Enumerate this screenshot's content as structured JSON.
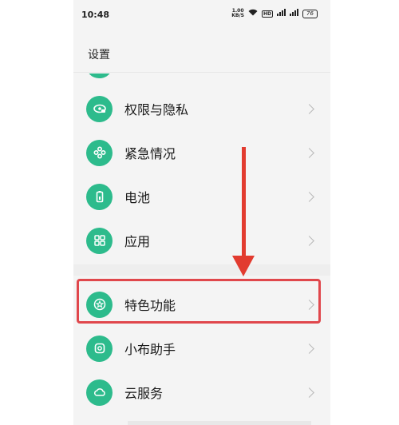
{
  "status_bar": {
    "time": "10:48",
    "net_speed_value": "1.00",
    "net_speed_unit": "KB/S",
    "hd_label": "HD",
    "battery_level": "76"
  },
  "header": {
    "title": "设置"
  },
  "menu": {
    "items": [
      {
        "label": "权限与隐私",
        "icon": "eye-lock-icon"
      },
      {
        "label": "紧急情况",
        "icon": "asterisk-icon"
      },
      {
        "label": "电池",
        "icon": "battery-icon"
      },
      {
        "label": "应用",
        "icon": "apps-grid-icon"
      },
      {
        "label": "特色功能",
        "icon": "star-circle-icon"
      },
      {
        "label": "小布助手",
        "icon": "assistant-icon"
      },
      {
        "label": "云服务",
        "icon": "cloud-icon"
      }
    ]
  },
  "colors": {
    "accent": "#2dbb8c",
    "annotation": "#e0474c"
  }
}
